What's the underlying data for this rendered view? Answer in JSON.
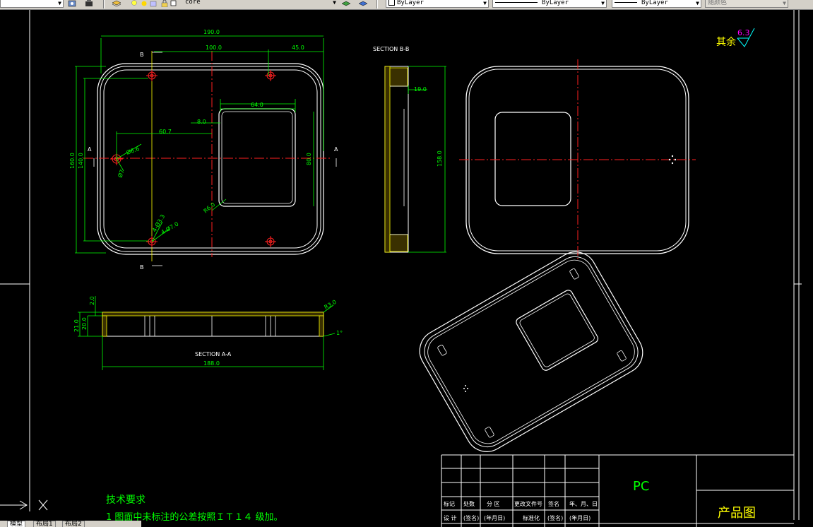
{
  "toolbar": {
    "layer_name": "core",
    "color": "ByLayer",
    "linetype": "ByLayer",
    "lineweight": "ByLayer",
    "plotstyle": "随颜色"
  },
  "drawing": {
    "roughness_prefix": "其余",
    "roughness_value": "6.3",
    "section_bb": "SECTION B-B",
    "section_aa": "SECTION A-A",
    "label_a": "A",
    "label_b": "B",
    "dims": {
      "d190": "190.0",
      "d100": "100.0",
      "d45": "45.0",
      "d64": "64.0",
      "d8": "8.0",
      "d60_7": "60.7",
      "d80": "80.0",
      "d160": "160.0",
      "d140": "140.0",
      "d6_6": "Ø6.6",
      "d7": "Ø7",
      "r6": "R6.0",
      "d4_3": "4-Ø3.3",
      "d4_7": "4-Ø7.0",
      "d19": "19.0",
      "d158": "158.0",
      "d2": "2.0",
      "d21": "21.0",
      "d20": "20.0",
      "d188": "188.0",
      "dr3": "R3.0",
      "ang": "1°"
    },
    "tech_title": "技术要求",
    "tech_line": "1   图面中未标注的公差按照ＩＴ１４ 级加。"
  },
  "title_block": {
    "material": "PC",
    "product": "产品图",
    "headers": [
      "标记",
      "处数",
      "分 区",
      "更改文件号",
      "签名",
      "年、月、日"
    ],
    "row2": [
      "设 计",
      "(签名)",
      "(年月日)",
      "标准化",
      "(签名)",
      "(年月日)"
    ]
  },
  "cursor": {
    "x_label": "X"
  },
  "tabs": [
    "模型",
    "布局1",
    "布局2"
  ],
  "colors": {
    "green": "#00ff00",
    "yellow": "#ffff00",
    "red": "#ff2020",
    "cyan": "#00ffff",
    "magenta": "#ff00ff",
    "white": "#ffffff"
  }
}
